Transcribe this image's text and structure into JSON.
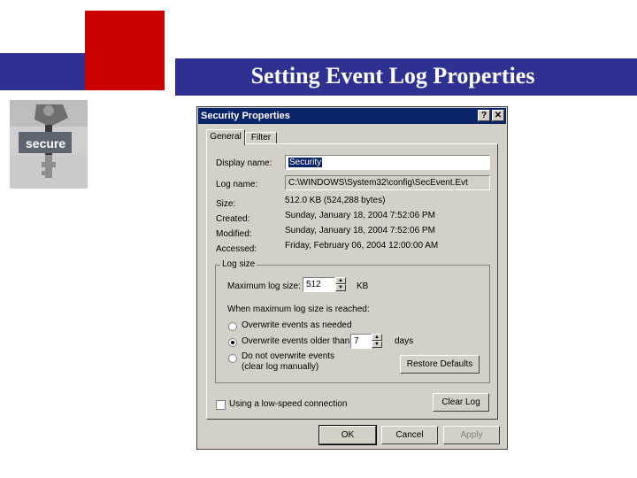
{
  "slide": {
    "title": "Setting Event Log Properties"
  },
  "logo": {
    "text": "secure"
  },
  "dialog": {
    "title": "Security Properties",
    "help_button": "?",
    "close_button": "✕",
    "tabs": [
      "General",
      "Filter"
    ],
    "display_name_label": "Display name:",
    "display_name_value": "Security",
    "log_name_label": "Log name:",
    "log_name_value": "C:\\WINDOWS\\System32\\config\\SecEvent.Evt",
    "size_label": "Size:",
    "size_value": "512.0 KB (524,288 bytes)",
    "created_label": "Created:",
    "created_value": "Sunday, January 18, 2004 7:52:06 PM",
    "modified_label": "Modified:",
    "modified_value": "Sunday, January 18, 2004 7:52:06 PM",
    "accessed_label": "Accessed:",
    "accessed_value": "Friday, February 06, 2004 12:00:00 AM",
    "log_size_group": "Log size",
    "max_size_label": "Maximum log size:",
    "max_size_value": "512",
    "max_size_unit": "KB",
    "when_reached_label": "When maximum log size is reached:",
    "radio_overwrite_as_needed": "Overwrite events as needed",
    "radio_overwrite_older": "Overwrite events older than",
    "days_value": "7",
    "days_label": "days",
    "radio_do_not_overwrite_1": "Do not overwrite events",
    "radio_do_not_overwrite_2": "(clear log manually)",
    "restore_defaults_button": "Restore Defaults",
    "low_speed_label": "Using a low-speed connection",
    "clear_log_button": "Clear Log",
    "ok_button": "OK",
    "cancel_button": "Cancel",
    "apply_button": "Apply",
    "selected_radio": "overwrite_older"
  }
}
